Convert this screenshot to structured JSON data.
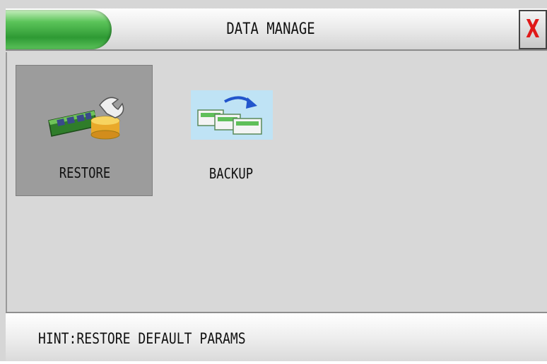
{
  "window": {
    "title": "DATA MANAGE",
    "close_label": "X",
    "accent_color": "#3aa93e",
    "close_color": "#e01818"
  },
  "tiles": [
    {
      "label": "RESTORE",
      "icon": "restore-icon",
      "selected": true
    },
    {
      "label": "BACKUP",
      "icon": "backup-icon",
      "selected": false
    }
  ],
  "hint": {
    "text": "HINT:RESTORE DEFAULT PARAMS"
  }
}
